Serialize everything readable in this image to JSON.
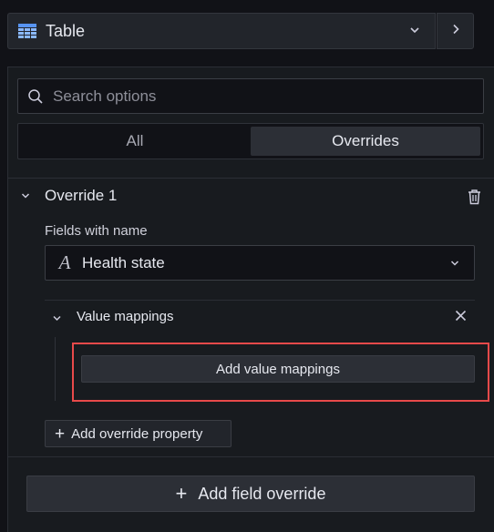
{
  "visualization": {
    "title": "Table",
    "icon": "table-icon",
    "accent_color": "#5794f2"
  },
  "search": {
    "placeholder": "Search options",
    "value": ""
  },
  "tabs": [
    {
      "label": "All",
      "active": false
    },
    {
      "label": "Overrides",
      "active": true
    }
  ],
  "override": {
    "title": "Override 1",
    "matcher_label": "Fields with name",
    "matcher_value": "Health state",
    "properties": [
      {
        "title": "Value mappings",
        "add_button_label": "Add value mappings"
      }
    ],
    "add_property_label": "Add override property"
  },
  "add_field_override_label": "Add field override",
  "highlight_color": "#e84a4a"
}
